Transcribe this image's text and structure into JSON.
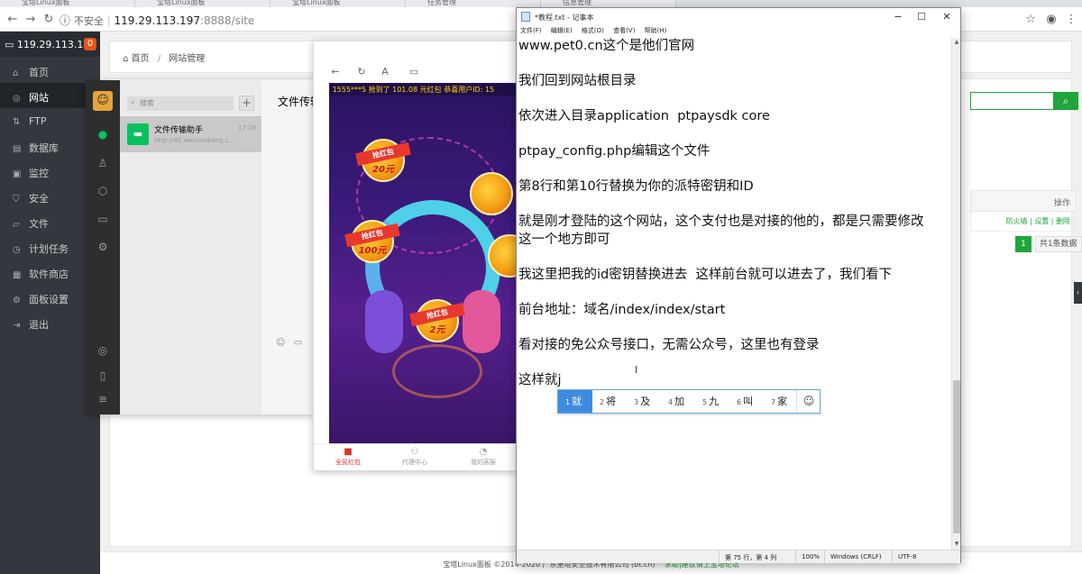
{
  "browser": {
    "tabs": [
      "宝塔Linux面板",
      "宝塔Linux面板",
      "宝塔Linux面板",
      "任务管理",
      "信息管理"
    ],
    "insecure_label": "不安全",
    "url_host": "119.29.113.197",
    "url_port": ":8888",
    "url_path": "/site"
  },
  "panel": {
    "server_ip": "119.29.113.197",
    "badge": "0",
    "menu": [
      {
        "label": "首页",
        "icon": "home-icon"
      },
      {
        "label": "网站",
        "icon": "globe-icon",
        "active": true
      },
      {
        "label": "FTP",
        "icon": "ftp-icon"
      },
      {
        "label": "数据库",
        "icon": "database-icon"
      },
      {
        "label": "监控",
        "icon": "monitor-icon"
      },
      {
        "label": "安全",
        "icon": "shield-icon"
      },
      {
        "label": "文件",
        "icon": "folder-icon"
      },
      {
        "label": "计划任务",
        "icon": "clock-icon"
      },
      {
        "label": "软件商店",
        "icon": "store-icon"
      },
      {
        "label": "面板设置",
        "icon": "gear-icon"
      },
      {
        "label": "退出",
        "icon": "logout-icon"
      }
    ],
    "breadcrumb_home": "首页",
    "breadcrumb_sep": "/",
    "breadcrumb_current": "网站管理",
    "table_header_action": "操作",
    "row_actions": "防火墙 | 设置 | 删除",
    "page_num": "1",
    "total": "共1条数据",
    "footer_text": "宝塔Linux面板 ©2014-2020 广东堡塔安全技术有限公司 (bt.cn)",
    "footer_link": "求助|建议请上宝塔论坛"
  },
  "wechat": {
    "search_placeholder": "搜索",
    "chat_name": "文件传输助手",
    "chat_time": "17:28",
    "chat_preview": "http://85.weixiaobang.c...",
    "chat_title": "文件传输"
  },
  "phone": {
    "marquee": "PID: 1555***5 抢到了 101.08 元红包 恭喜用户ID: 15",
    "envelopes": [
      {
        "label": "抢红包",
        "amount": "20元"
      },
      {
        "label": "抢红包",
        "amount": "100元"
      },
      {
        "label": "抢红包",
        "amount": "2元"
      }
    ],
    "tabs": [
      {
        "label": "全民红包",
        "active": true
      },
      {
        "label": "代理中心"
      },
      {
        "label": "我的客服"
      }
    ]
  },
  "notepad": {
    "title": "*教程.txt - 记事本",
    "menu": [
      "文件(F)",
      "编辑(E)",
      "格式(O)",
      "查看(V)",
      "帮助(H)"
    ],
    "lines": [
      "www.pet0.cn这个是他们官网",
      "",
      "我们回到网站根目录",
      "",
      "依次进入目录application  ptpaysdk core",
      "",
      "ptpay_config.php编辑这个文件",
      "",
      "第8行和第10行替换为你的派特密钥和ID",
      "",
      "就是刚才登陆的这个网站，这个支付也是对接的他的，都是只需要修改",
      "这一个地方即可",
      "",
      "我这里把我的id密钥替换进去  这样前台就可以进去了，我们看下",
      "",
      "前台地址：域名/index/index/start",
      "",
      "看对接的免公众号接口，无需公众号，这里也有登录",
      "",
      "这样就j"
    ],
    "status_pos": "第 75 行，第 4 列",
    "status_zoom": "100%",
    "status_eol": "Windows (CRLF)",
    "status_enc": "UTF-8"
  },
  "ime": {
    "candidates": [
      {
        "n": "1",
        "c": "就",
        "selected": true
      },
      {
        "n": "2",
        "c": "将"
      },
      {
        "n": "3",
        "c": "及"
      },
      {
        "n": "4",
        "c": "加"
      },
      {
        "n": "5",
        "c": "九"
      },
      {
        "n": "6",
        "c": "叫"
      },
      {
        "n": "7",
        "c": "家"
      }
    ]
  }
}
